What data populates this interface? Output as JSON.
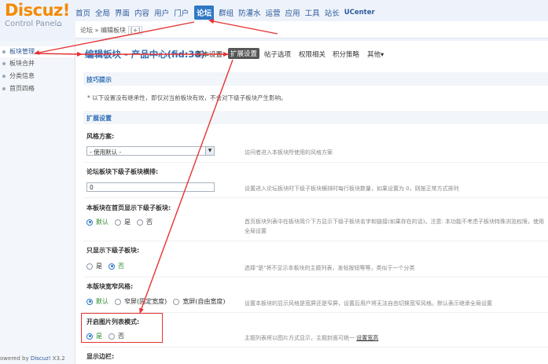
{
  "logo": {
    "brand": "Discuz!",
    "subtitle": "Control Panel"
  },
  "topnav": [
    {
      "label": "首页"
    },
    {
      "label": "全局"
    },
    {
      "label": "界面"
    },
    {
      "label": "内容"
    },
    {
      "label": "用户"
    },
    {
      "label": "门户"
    },
    {
      "label": "论坛",
      "active": true
    },
    {
      "label": "群组"
    },
    {
      "label": "防灌水"
    },
    {
      "label": "运营"
    },
    {
      "label": "应用"
    },
    {
      "label": "工具"
    },
    {
      "label": "站长"
    },
    {
      "label": "UCenter"
    }
  ],
  "breadcrumb": {
    "text": "论坛 » 编辑板块",
    "button": "[+]"
  },
  "sidebar": {
    "items": [
      "板块管理",
      "板块合并",
      "分类信息",
      "首页四格"
    ],
    "selected_index": 0
  },
  "footer": {
    "prefix": "owered by ",
    "link": "Discuz!",
    "version": " X3.2"
  },
  "page": {
    "title": "编辑板块 - 产品中心(fid:38)",
    "tabs": [
      "基本设置",
      "扩展设置",
      "帖子选项",
      "权限相关",
      "积分策略",
      "其他▾"
    ],
    "active_tab": 1
  },
  "tips": {
    "header": "技巧提示",
    "text": "* 以下设置没有继承性，即仅对当前板块有效，不会对下级子板块产生影响。"
  },
  "section": {
    "header": "扩展设置"
  },
  "settings": {
    "style": {
      "label": "风格方案:",
      "value": "- 使用默认 -",
      "desc": "访问者进入本板块所使用的风格方案"
    },
    "sub_cols": {
      "label": "论坛板块下级子板块横排:",
      "value": "0",
      "desc": "设置进入论坛板块时下级子板块横排时每行板块数量，如果设置为 0，则按正常方式排列"
    },
    "show_sub": {
      "label": "本板块在首页显示下级子板块:",
      "options": [
        "默认",
        "是",
        "否"
      ],
      "selected": 0,
      "desc": "首页板块列表中在板块简介下方显示下级子板块名字和链接(如果存在的话)。注意: 本功能不考虑子板块特殊浏览权限，使用全局设置"
    },
    "only_sub": {
      "label": "只显示下级子板块:",
      "options": [
        "是",
        "否"
      ],
      "selected": 1,
      "desc": "选择\"是\"将不显示本板块的主题列表，发帖按钮等等，类似于一个分类"
    },
    "width": {
      "label": "本版块宽窄风格:",
      "options": [
        "默认",
        "窄屏(固定宽度)",
        "宽屏(自由宽度)"
      ],
      "selected": 0,
      "desc": "设置本板块的显示风格是宽屏还是窄屏，设置后用户将无法自由切换宽窄风格。默认表示继承全局设置"
    },
    "picture_list": {
      "label": "开启图片列表模式:",
      "options": [
        "是",
        "否"
      ],
      "selected": 0,
      "desc": "主题列表将以图片方式显示，主题封面可统一",
      "desc_link": "设置宽高"
    },
    "sidebar_show": {
      "label": "显示边栏:"
    }
  },
  "annotation": {
    "color": "#e53232"
  }
}
